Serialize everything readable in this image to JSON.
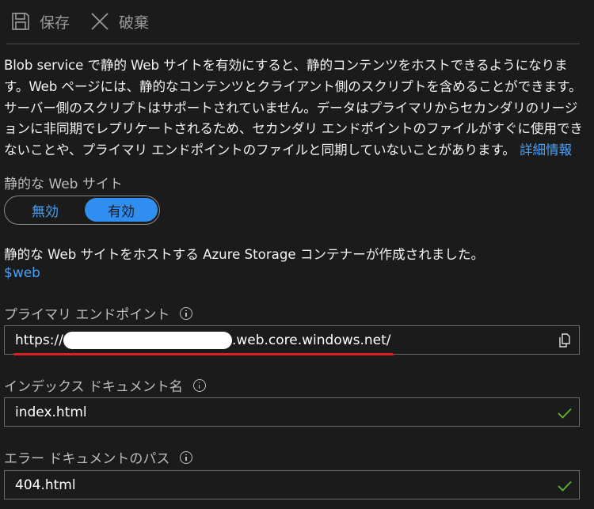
{
  "toolbar": {
    "save_label": "保存",
    "discard_label": "破棄"
  },
  "description": {
    "text": "Blob service で静的 Web サイトを有効にすると、静的コンテンツをホストできるようになります。Web ページには、静的なコンテンツとクライアント側のスクリプトを含めることができます。サーバー側のスクリプトはサポートされていません。データはプライマリからセカンダリのリージョンに非同期でレプリケートされるため、セカンダリ エンドポイントのファイルがすぐに使用できないことや、プライマリ エンドポイントのファイルと同期していないことがあります。",
    "link": "詳細情報"
  },
  "static_website": {
    "label": "静的な Web サイト",
    "off_label": "無効",
    "on_label": "有効",
    "selected": "有効"
  },
  "message": "静的な Web サイトをホストする Azure Storage コンテナーが作成されました。",
  "container_link": "$web",
  "primary_endpoint": {
    "label": "プライマリ エンドポイント",
    "value_prefix": "https://",
    "value_suffix": ".web.core.windows.net/"
  },
  "index_document": {
    "label": "インデックス ドキュメント名",
    "value": "index.html"
  },
  "error_document": {
    "label": "エラー ドキュメントのパス",
    "value": "404.html"
  },
  "colors": {
    "accent": "#2f8ef0",
    "link": "#4aa0f5",
    "check": "#5fb832",
    "underline": "#e02020"
  }
}
